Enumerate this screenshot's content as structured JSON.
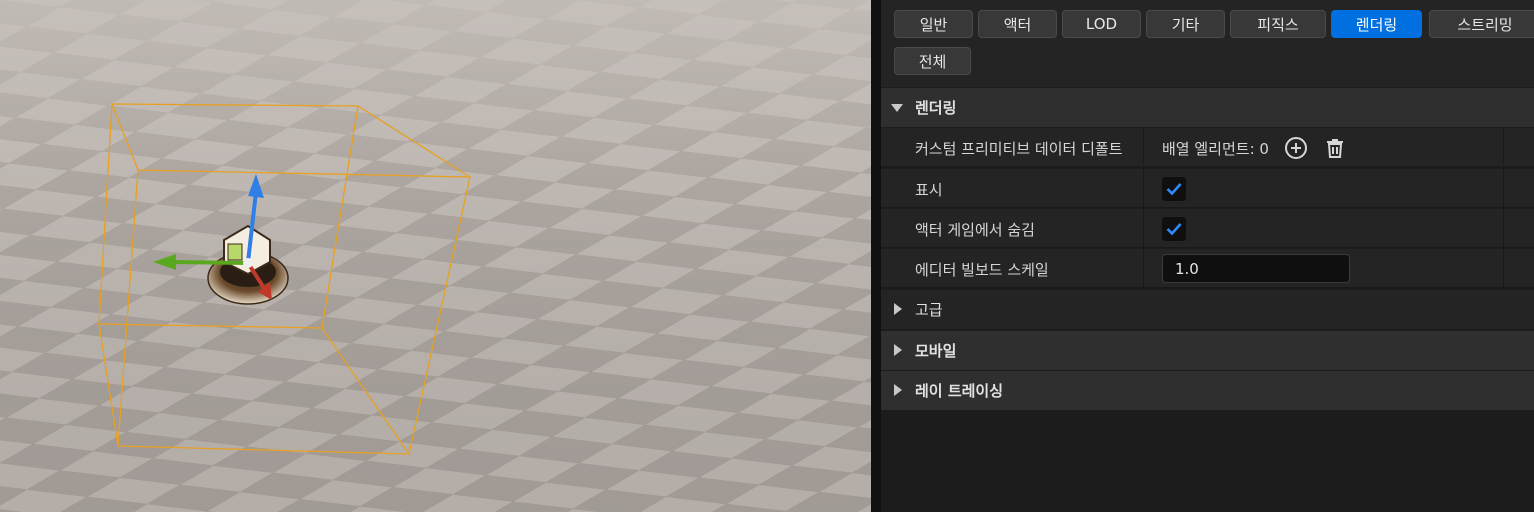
{
  "tabs": [
    {
      "label": "일반",
      "active": false
    },
    {
      "label": "액터",
      "active": false
    },
    {
      "label": "LOD",
      "active": false
    },
    {
      "label": "기타",
      "active": false
    },
    {
      "label": "피직스",
      "active": false
    },
    {
      "label": "렌더링",
      "active": true
    },
    {
      "label": "스트리밍",
      "active": false
    },
    {
      "label": "전체",
      "active": false
    }
  ],
  "rendering": {
    "header": "렌더링",
    "expanded": true,
    "properties": {
      "custom_primitive_data": {
        "name": "커스텀 프리미티브 데이터 디폴트",
        "value": "배열 엘리먼트: 0"
      },
      "visible": {
        "name": "표시",
        "checked": true
      },
      "hidden_in_game": {
        "name": "액터 게임에서 숨김",
        "checked": true
      },
      "billboard_scale": {
        "name": "에디터 빌보드 스케일",
        "value": "1.0"
      }
    }
  },
  "sections": {
    "advanced": "고급",
    "mobile": "모바일",
    "ray_tracing": "레이 트레이싱"
  },
  "icons": {
    "add": "add-circle-icon",
    "delete": "trash-icon",
    "expand": "triangle-down-icon",
    "collapse": "triangle-right-icon"
  },
  "colors": {
    "accent": "#0070e0",
    "selection_box": "#e8a020",
    "gizmo_x": "#c0392b",
    "gizmo_y": "#5aa820",
    "gizmo_z": "#2f7fe6"
  }
}
